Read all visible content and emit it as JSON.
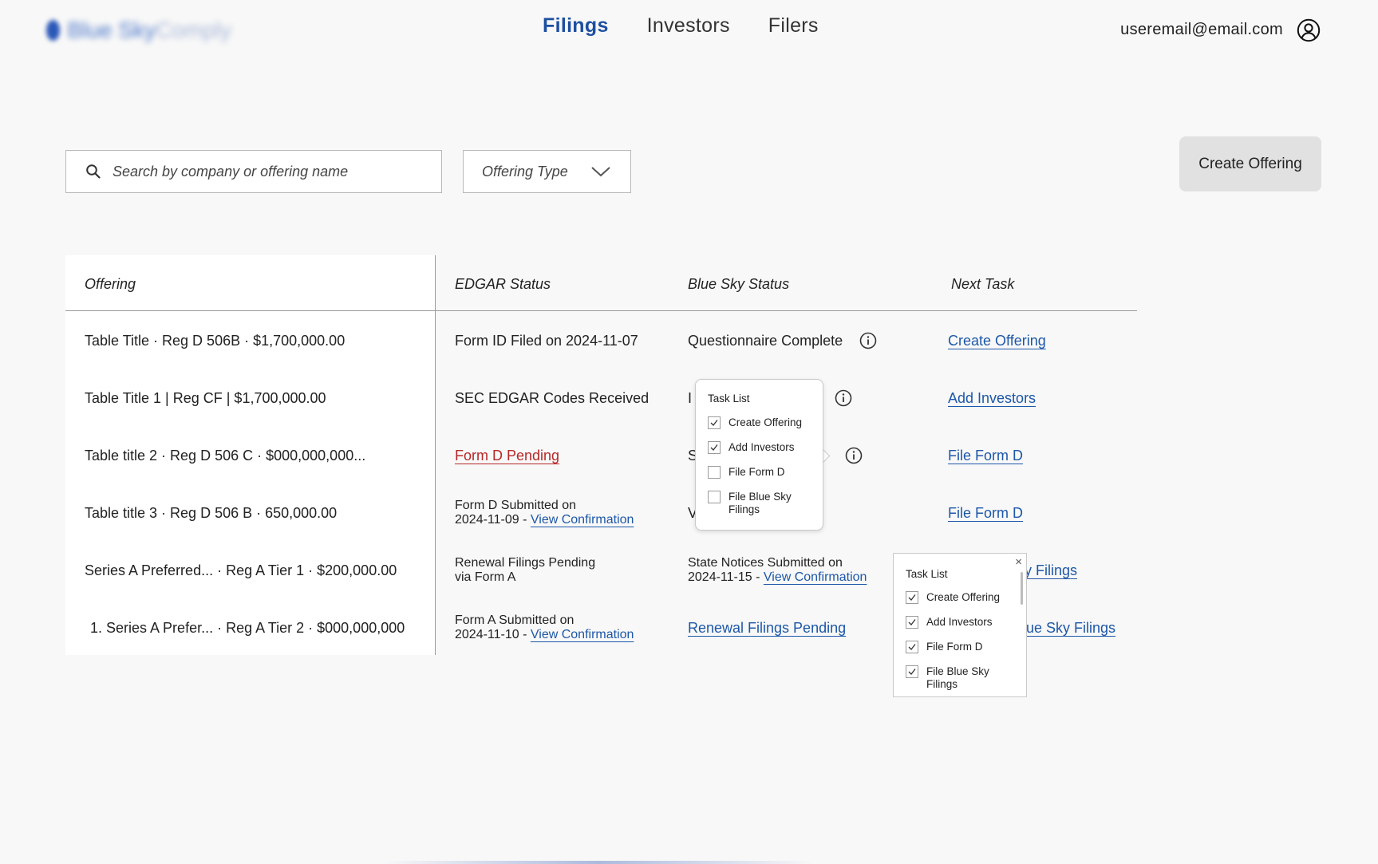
{
  "header": {
    "logo_text_main": "Blue Sky",
    "logo_text_light": "Comply",
    "nav": [
      {
        "label": "Filings",
        "active": true
      },
      {
        "label": "Investors",
        "active": false
      },
      {
        "label": "Filers",
        "active": false
      }
    ],
    "user_email": "useremail@email.com"
  },
  "filters": {
    "search_placeholder": "Search by company or offering name",
    "offering_type_label": "Offering Type"
  },
  "toolbar": {
    "create_offering_label": "Create Offering"
  },
  "table": {
    "headers": {
      "offering": "Offering",
      "edgar": "EDGAR Status",
      "bluesky": "Blue Sky Status",
      "next": "Next Task"
    },
    "rows": [
      {
        "offering": "Table Title · Reg D 506B · $1,700,000.00",
        "edgar": "Form ID Filed on 2024-11-07",
        "bluesky": "Questionnaire Complete",
        "next": "Create Offering"
      },
      {
        "offering": "Table Title 1 | Reg CF  | $1,700,000.00",
        "edgar": "SEC EDGAR Codes Received",
        "bluesky_partial": "I",
        "next": "Add Investors"
      },
      {
        "offering": "Table title 2 · Reg D 506 C · $000,000,000...",
        "edgar_link": "Form D Pending",
        "bluesky_partial": "S",
        "next": "File Form D"
      },
      {
        "offering": "Table title 3 · Reg D 506 B · 650,000.00",
        "edgar_line1": "Form D Submitted on",
        "edgar_date": "2024-11-09 - ",
        "edgar_link": "View Confirmation",
        "bluesky_partial": "V",
        "next": "File Form D"
      },
      {
        "offering": "Series A Preferred...  · Reg A Tier 1 · $200,000.00",
        "edgar_line1": "Renewal Filings Pending",
        "edgar_line2": "via Form A",
        "bluesky_line1": "State Notices Submitted on",
        "bluesky_date": "2024-11-15 - ",
        "bluesky_link": "View Confirmation",
        "next_partial": "y Filings"
      },
      {
        "offering": "1. Series A Prefer... · Reg A Tier 2 · $000,000,000",
        "edgar_line1": "Form A Submitted on",
        "edgar_date": "2024-11-10 - ",
        "edgar_link": "View Confirmation",
        "bluesky_link": "Renewal Filings Pending",
        "next_partial": "ue Sky Filings"
      }
    ]
  },
  "popover_1": {
    "title": "Task List",
    "tasks": [
      {
        "label": "Create Offering",
        "checked": true
      },
      {
        "label": "Add Investors",
        "checked": true
      },
      {
        "label": "File Form D",
        "checked": false
      },
      {
        "label_1": "File Blue Sky",
        "label_2": "Filings",
        "checked": false
      }
    ]
  },
  "popover_2": {
    "title": "Task List",
    "close": "×",
    "tasks": [
      {
        "label": "Create Offering",
        "checked": true
      },
      {
        "label": "Add Investors",
        "checked": true
      },
      {
        "label": "File Form D",
        "checked": true
      },
      {
        "label_1": "File Blue Sky",
        "label_2": "Filings",
        "checked": true
      }
    ]
  },
  "colors": {
    "accent": "#1e4fa0",
    "link": "#1d57a8",
    "warning": "#b62828",
    "button_bg": "#e1e1e1"
  }
}
